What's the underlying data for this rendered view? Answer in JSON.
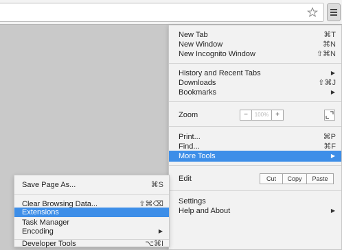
{
  "main_menu": {
    "new_tab": {
      "label": "New Tab",
      "shortcut": "⌘T"
    },
    "new_window": {
      "label": "New Window",
      "shortcut": "⌘N"
    },
    "new_incognito": {
      "label": "New Incognito Window",
      "shortcut": "⇧⌘N"
    },
    "history": {
      "label": "History and Recent Tabs"
    },
    "downloads": {
      "label": "Downloads",
      "shortcut": "⇧⌘J"
    },
    "bookmarks": {
      "label": "Bookmarks"
    },
    "zoom": {
      "label": "Zoom",
      "minus": "−",
      "value": "100%",
      "plus": "+"
    },
    "print": {
      "label": "Print...",
      "shortcut": "⌘P"
    },
    "find": {
      "label": "Find...",
      "shortcut": "⌘F"
    },
    "more_tools": {
      "label": "More Tools"
    },
    "edit": {
      "label": "Edit",
      "cut": "Cut",
      "copy": "Copy",
      "paste": "Paste"
    },
    "settings": {
      "label": "Settings"
    },
    "help": {
      "label": "Help and About"
    }
  },
  "more_tools_menu": {
    "save_page": {
      "label": "Save Page As...",
      "shortcut": "⌘S"
    },
    "clear_data": {
      "label": "Clear Browsing Data...",
      "shortcut": "⇧⌘⌫"
    },
    "extensions": {
      "label": "Extensions"
    },
    "task_manager": {
      "label": "Task Manager"
    },
    "encoding": {
      "label": "Encoding"
    },
    "developer_tools": {
      "label": "Developer Tools",
      "shortcut": "⌥⌘I"
    }
  },
  "icons": {
    "star": "star-icon",
    "menu": "hamburger-menu-icon",
    "submenu_arrow": "▶",
    "fullscreen": "fullscreen-icon"
  },
  "colors": {
    "highlight": "#3d8ee8",
    "menu_bg": "#f2f2f2",
    "page_bg": "#c9c9c9"
  }
}
